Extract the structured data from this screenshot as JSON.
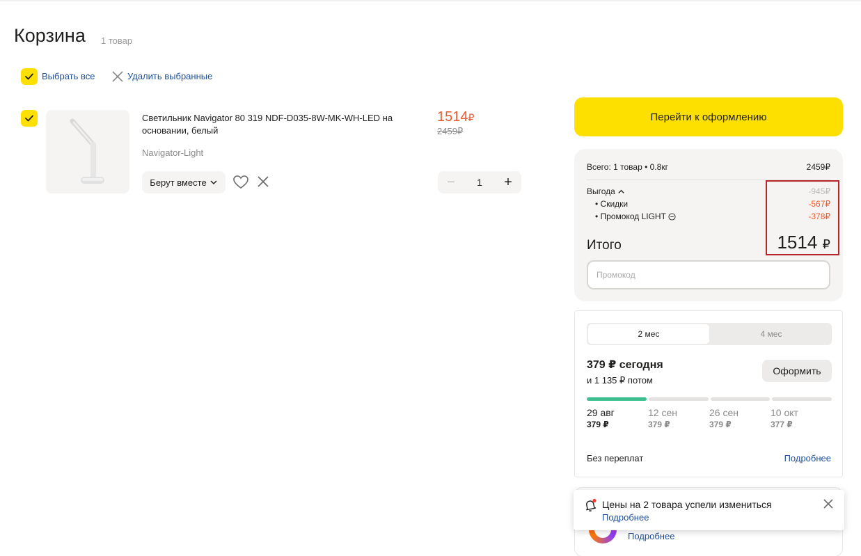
{
  "header": {
    "title": "Корзина",
    "count": "1 товар"
  },
  "toolbar": {
    "select_all": "Выбрать все",
    "delete_selected": "Удалить выбранные"
  },
  "product": {
    "title": "Светильник Navigator 80 319 NDF-D035-8W-MK-WH-LED на основании, белый",
    "brand": "Navigator-Light",
    "together_label": "Берут вместе",
    "price_now": "1514",
    "price_old": "2459₽",
    "currency": "₽",
    "quantity": "1",
    "qty_minus": "−",
    "qty_plus": "+"
  },
  "checkout": {
    "button_label": "Перейти к оформлению"
  },
  "summary": {
    "total_label": "Всего: 1 товар • 0.8кг",
    "total_value": "2459₽",
    "benefit_label": "Выгода",
    "benefit_value": "-945₽",
    "discounts_label": "• Скидки",
    "discounts_value": "-567₽",
    "promo_label": "• Промокод LIGHT",
    "promo_value": "-378₽",
    "itogo_label": "Итого",
    "itogo_value": "1514",
    "promo_placeholder": "Промокод"
  },
  "split": {
    "tabs": [
      "2 мес",
      "4 мес"
    ],
    "today": "379 ₽ сегодня",
    "then": "и 1 135 ₽ потом",
    "button_label": "Оформить",
    "payments": [
      {
        "date": "29 авг",
        "amount": "379 ₽"
      },
      {
        "date": "12 сен",
        "amount": "379 ₽"
      },
      {
        "date": "26 сен",
        "amount": "379 ₽"
      },
      {
        "date": "10 окт",
        "amount": "377 ₽"
      }
    ],
    "no_overpay": "Без переплат",
    "more": "Подробнее"
  },
  "promo_card": {
    "more": "Подробнее"
  },
  "toast": {
    "text": "Цены на 2 товара успели измениться",
    "more": "Подробнее"
  },
  "colors": {
    "accent": "#fde000",
    "price": "#ec5a2c",
    "link": "#1f4f9a",
    "progress": "#3fbf8f",
    "highlight": "#b5262a"
  }
}
